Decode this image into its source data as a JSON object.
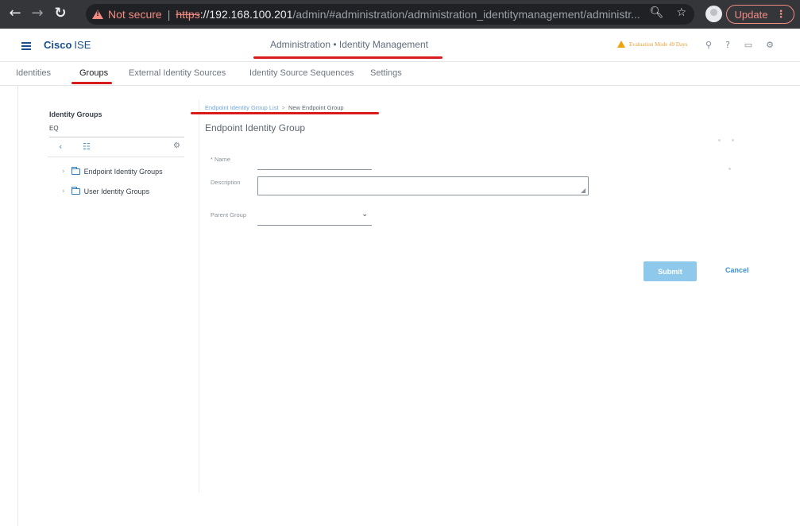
{
  "browser": {
    "not_secure": "Not secure",
    "url_scheme": "https",
    "url_sep": "://",
    "url_host": "192.168.100.201",
    "url_path": "/admin/#administration/administration_identitymanagement/administr...",
    "update_label": "Update"
  },
  "header": {
    "brand_bold": "Cisco",
    "brand_light": "ISE",
    "title": "Administration • Identity Management",
    "evaluation": "Evaluation Mode 49 Days"
  },
  "tabs": [
    {
      "label": "Identities"
    },
    {
      "label": "Groups"
    },
    {
      "label": "External Identity Sources"
    },
    {
      "label": "Identity Source Sequences"
    },
    {
      "label": "Settings"
    }
  ],
  "left_panel": {
    "title": "Identity Groups",
    "search_value": "EQ",
    "tree": [
      {
        "label": "Endpoint Identity Groups"
      },
      {
        "label": "User Identity Groups"
      }
    ]
  },
  "breadcrumb": {
    "link": "Endpoint Identity Group List",
    "separator": ">",
    "current": "New Endpoint Group"
  },
  "form": {
    "title": "Endpoint Identity Group",
    "name_label": "* Name",
    "name_value": "",
    "description_label": "Description",
    "description_value": "",
    "parent_label": "Parent Group",
    "parent_value": ""
  },
  "actions": {
    "submit": "Submit",
    "cancel": "Cancel"
  },
  "colors": {
    "brand": "#1b4f8c",
    "annotation_red": "#d91b1b",
    "submit_bg": "#8ec9ec",
    "link": "#3b8fd1",
    "warning": "#f0a30a"
  }
}
